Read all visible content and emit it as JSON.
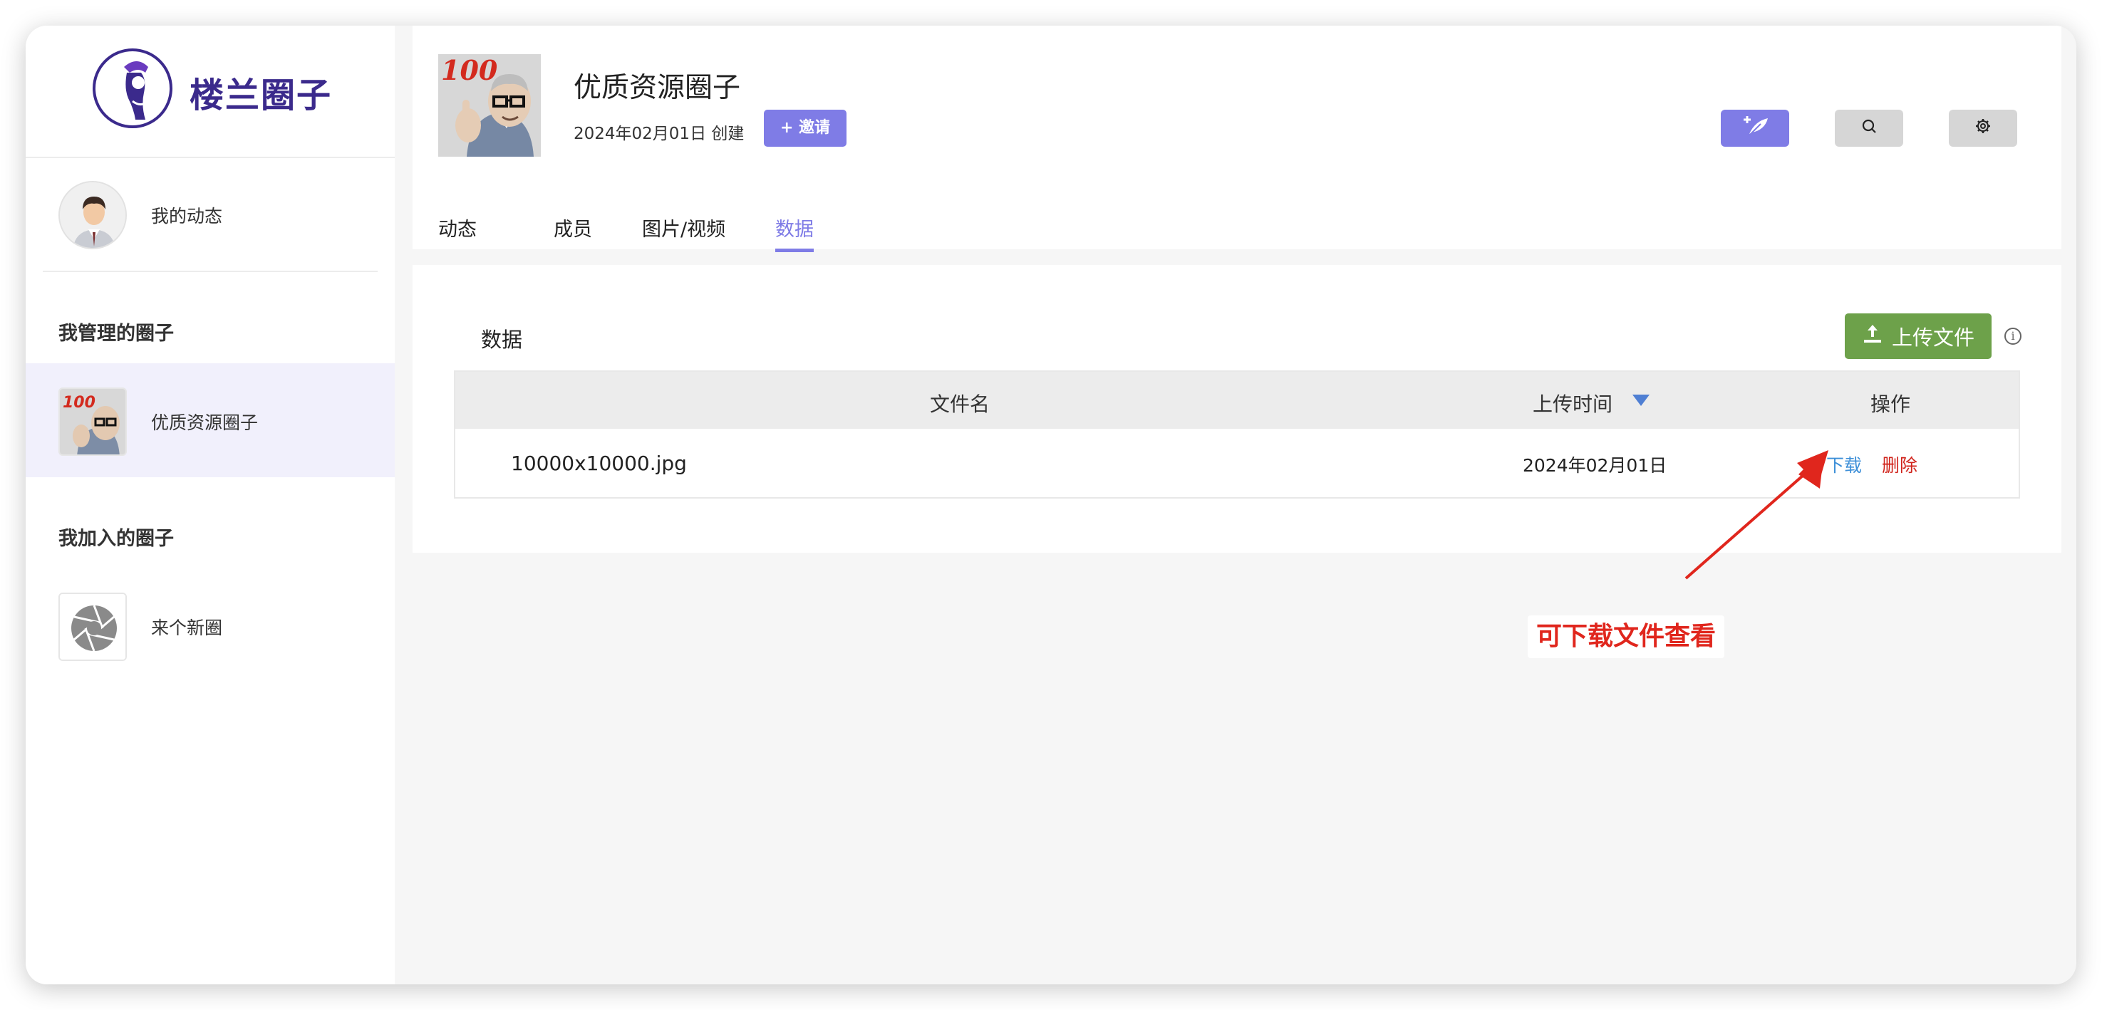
{
  "brand": {
    "name": "楼兰圈子"
  },
  "sidebar": {
    "me_label": "我的动态",
    "managed_title": "我管理的圈子",
    "managed_items": [
      {
        "label": "优质资源圈子"
      }
    ],
    "joined_title": "我加入的圈子",
    "joined_items": [
      {
        "label": "来个新圈"
      }
    ]
  },
  "header": {
    "group_title": "优质资源圈子",
    "created": "2024年02月01日 创建",
    "invite_label": "+ 邀请",
    "cover_badge": "100",
    "tools": [
      {
        "icon": "feather-plus-icon"
      },
      {
        "icon": "search-icon"
      },
      {
        "icon": "gear-icon"
      }
    ]
  },
  "tabs": [
    {
      "label": "动态",
      "active": false
    },
    {
      "label": "成员",
      "active": false
    },
    {
      "label": "图片/视频",
      "active": false
    },
    {
      "label": "数据",
      "active": true
    }
  ],
  "data_section": {
    "title": "数据",
    "upload_label": "上传文件",
    "table": {
      "columns": [
        "文件名",
        "上传时间",
        "操作"
      ],
      "sort_column": "上传时间",
      "sort_direction": "desc",
      "rows": [
        {
          "filename": "10000x10000.jpg",
          "uploaded": "2024年02月01日",
          "actions": [
            "下载",
            "删除"
          ]
        }
      ]
    }
  },
  "annotation": {
    "text": "可下载文件查看"
  },
  "colors": {
    "brand": "#3b2a8c",
    "accent": "#7f7ce6",
    "upload": "#6da14a",
    "download_link": "#3d8fd8",
    "delete_link": "#d0221a",
    "annotation": "#e0261d"
  }
}
